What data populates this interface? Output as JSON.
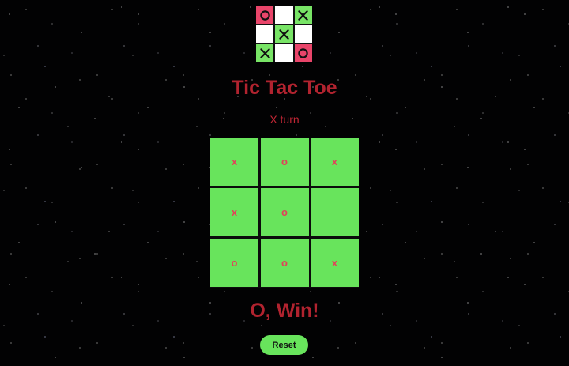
{
  "header": {
    "title": "Tic Tac Toe",
    "turn": "X turn"
  },
  "logo": {
    "cells": [
      {
        "mark": "o",
        "color": "pink"
      },
      {
        "mark": "",
        "color": "white"
      },
      {
        "mark": "x",
        "color": "green"
      },
      {
        "mark": "",
        "color": "white"
      },
      {
        "mark": "x",
        "color": "green"
      },
      {
        "mark": "",
        "color": "white"
      },
      {
        "mark": "x",
        "color": "green"
      },
      {
        "mark": "",
        "color": "white"
      },
      {
        "mark": "o",
        "color": "pink"
      }
    ]
  },
  "board": {
    "cells": [
      "x",
      "o",
      "x",
      "x",
      "o",
      "",
      "o",
      "o",
      "x"
    ]
  },
  "result": "O, Win!",
  "reset_label": "Reset",
  "colors": {
    "cell": "#68e45c",
    "mark": "#e2415a",
    "title": "#b1232f",
    "logo_pink": "#e9456a",
    "logo_green": "#78e466"
  }
}
